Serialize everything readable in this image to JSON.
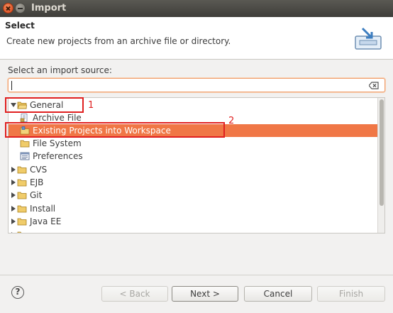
{
  "window": {
    "title": "Import"
  },
  "header": {
    "title": "Select",
    "description": "Create new projects from an archive file or directory."
  },
  "source": {
    "label": "Select an import source:",
    "filter_value": ""
  },
  "tree": {
    "items": [
      {
        "label": "General",
        "expanded": true,
        "icon": "folder-open-icon"
      },
      {
        "label": "Archive File",
        "icon": "archive-file-icon"
      },
      {
        "label": "Existing Projects into Workspace",
        "icon": "project-folder-icon",
        "selected": true
      },
      {
        "label": "File System",
        "icon": "folder-icon"
      },
      {
        "label": "Preferences",
        "icon": "preferences-icon"
      },
      {
        "label": "CVS",
        "icon": "folder-icon"
      },
      {
        "label": "EJB",
        "icon": "folder-icon"
      },
      {
        "label": "Git",
        "icon": "folder-icon"
      },
      {
        "label": "Install",
        "icon": "folder-icon"
      },
      {
        "label": "Java EE",
        "icon": "folder-icon"
      }
    ]
  },
  "annotations": {
    "one": "1",
    "two": "2",
    "color": "#e02020"
  },
  "buttons": {
    "back": "< Back",
    "next": "Next >",
    "cancel": "Cancel",
    "finish": "Finish",
    "help": "?"
  },
  "colors": {
    "selection": "#f07746",
    "titlebar": "#3e3d39"
  }
}
